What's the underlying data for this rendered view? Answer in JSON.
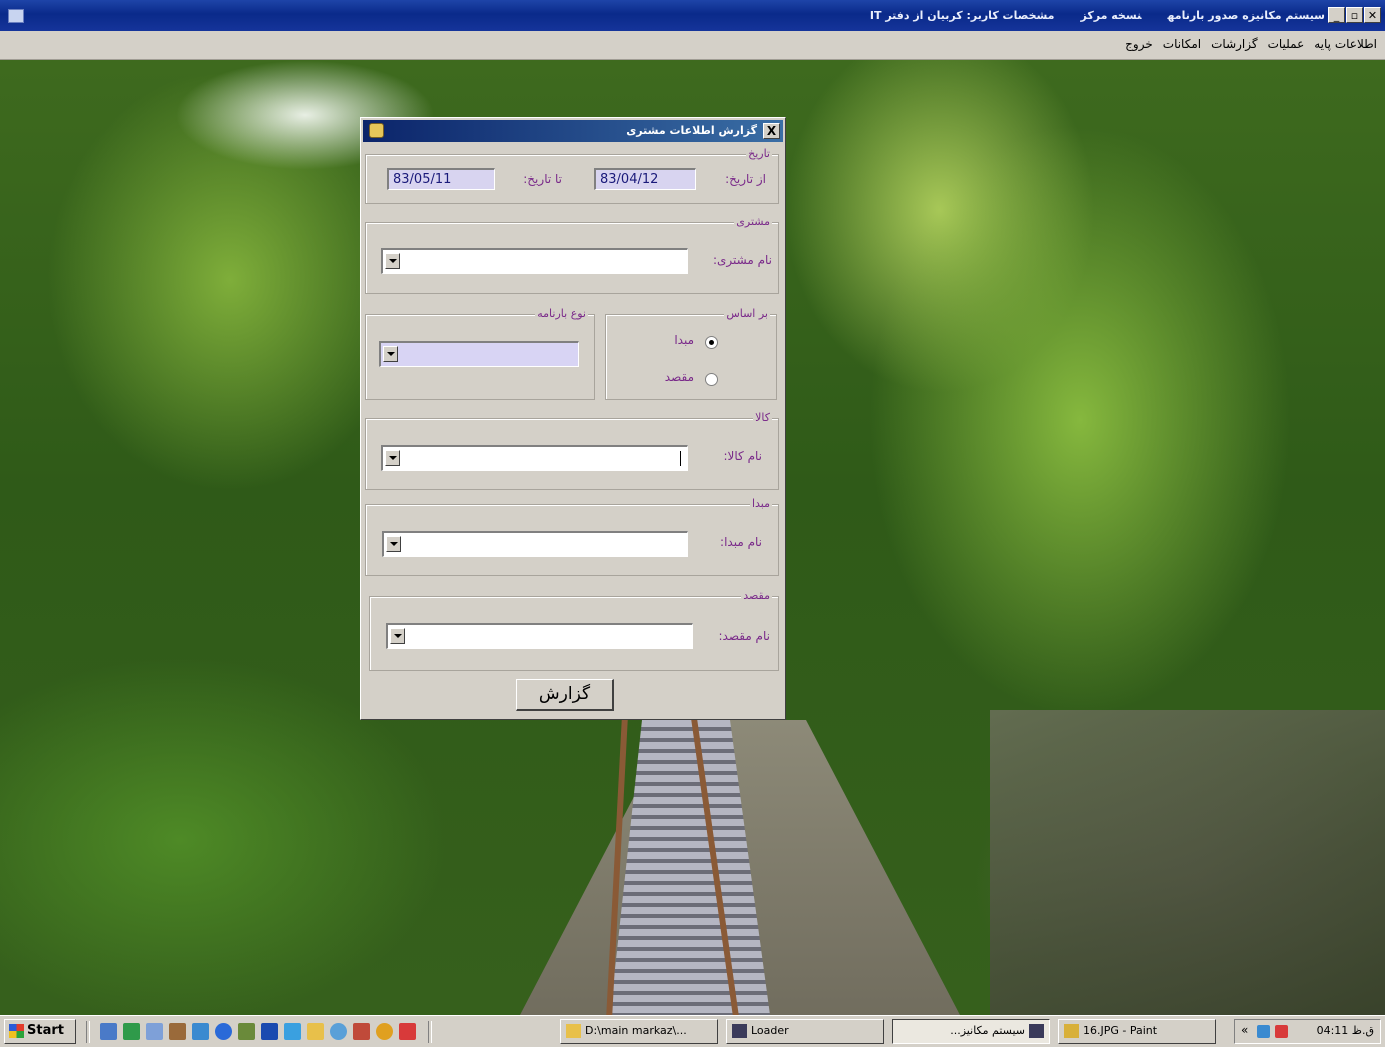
{
  "window": {
    "title_parts": [
      "سیستم مکانیزه صدور بارنامه",
      "نسخه مرکز",
      "مشخصات کاربر: کربیان از دفتر IT"
    ]
  },
  "menu": [
    "اطلاعات پایه",
    "عملیات",
    "گزارشات",
    "امکانات",
    "خروج"
  ],
  "dialog": {
    "title": "گزارش اطلاعات مشتری",
    "close_label": "X",
    "date_group": {
      "legend": "تاریخ",
      "from_label": "از تاریخ:",
      "from_value": "83/04/12",
      "to_label": "تا تاریخ:",
      "to_value": "83/05/11"
    },
    "customer_group": {
      "legend": "مشتری",
      "name_label": "نام مشتری:",
      "name_value": ""
    },
    "basis_group": {
      "legend": "بر اساس",
      "options": [
        "مبدا",
        "مقصد"
      ],
      "selected": "مبدا"
    },
    "waybill_type_group": {
      "legend": "نوع بارنامه",
      "value": ""
    },
    "goods_group": {
      "legend": "کالا",
      "name_label": "نام کالا:",
      "name_value": ""
    },
    "origin_group": {
      "legend": "مبدا",
      "name_label": "نام مبدا:",
      "name_value": ""
    },
    "destination_group": {
      "legend": "مقصد",
      "name_label": "نام مقصد:",
      "name_value": ""
    },
    "report_button": "گزارش"
  },
  "taskbar": {
    "start_label": "Start",
    "tasks": [
      "D:\\main markaz\\...",
      "Loader",
      "سیستم مکانیز...",
      "16.JPG - Paint"
    ],
    "active_task": "سیستم مکانیز...",
    "clock": "04:11 ق.ظ",
    "tray_chevron": "«"
  },
  "colors": {
    "title_bar": "#0a246a",
    "dialog_face": "#d4d0c8",
    "label_text": "#7a2a8a",
    "input_lilac": "#d8d4f0"
  }
}
